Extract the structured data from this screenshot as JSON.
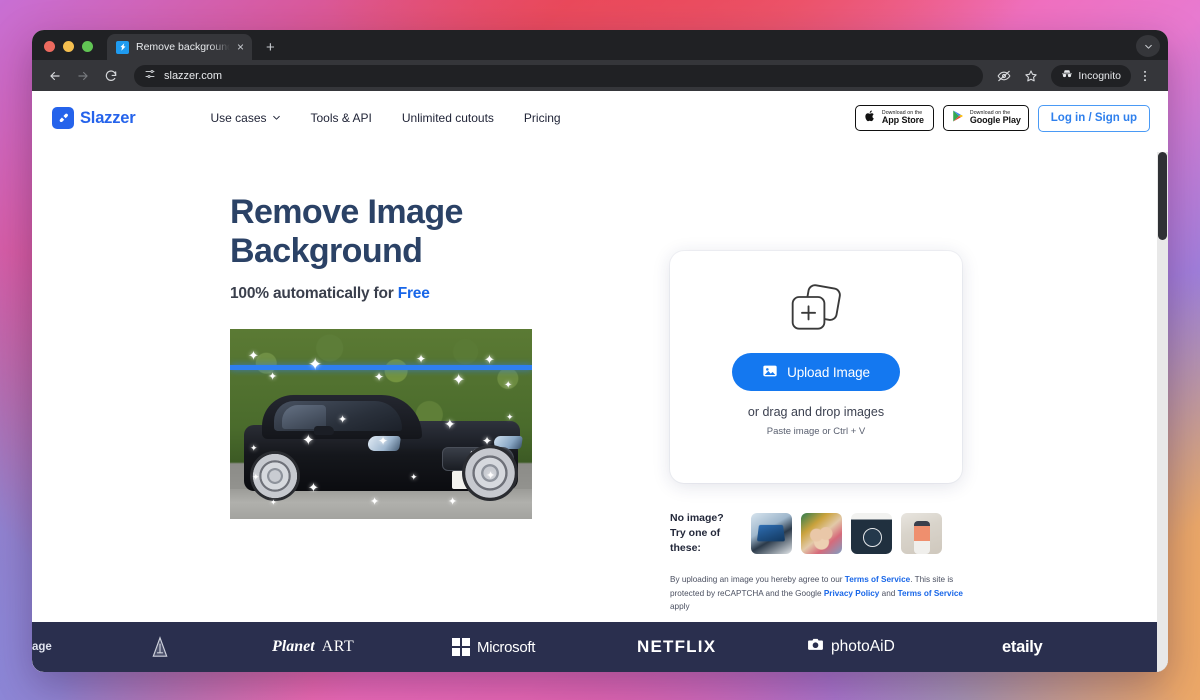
{
  "browser": {
    "tab": {
      "title": "Remove background from ima",
      "favicon": "slazzer-favicon",
      "close": "×"
    },
    "new_tab": "+",
    "tabstrip_menu": "chevron-down-icon",
    "toolbar": {
      "back": "back-arrow-icon",
      "forward": "forward-arrow-icon",
      "reload": "reload-icon",
      "site_info": "tune-icon",
      "url": "slazzer.com",
      "tracking_protection": "eye-slash-icon",
      "bookmark": "star-icon",
      "incognito_label": "Incognito",
      "menu": "three-dot-icon"
    }
  },
  "site": {
    "logo": {
      "text": "Slazzer",
      "mark": "slazzer-logo-icon"
    },
    "nav": [
      {
        "label": "Use cases",
        "has_caret": true
      },
      {
        "label": "Tools & API",
        "has_caret": false
      },
      {
        "label": "Unlimited cutouts",
        "has_caret": false
      },
      {
        "label": "Pricing",
        "has_caret": false
      }
    ],
    "app_store": {
      "small": "Download on the",
      "large": "App Store",
      "icon": "apple-icon"
    },
    "google_play": {
      "small": "Download on the",
      "large": "Google Play",
      "icon": "google-play-icon"
    },
    "login": "Log in / Sign up"
  },
  "hero": {
    "title_line1": "Remove Image",
    "title_line2": "Background",
    "subtitle_prefix": "100% automatically for ",
    "subtitle_highlight": "Free",
    "image_alt": "black-mercedes-coupe-with-sparkles"
  },
  "upload": {
    "stack_icon": "add-images-icon",
    "button_label": "Upload Image",
    "button_icon": "picture-icon",
    "drag_text": "or drag and drop images",
    "paste_text": "Paste image or Ctrl + V",
    "button_color": "#1478f0"
  },
  "samples": {
    "label_line1": "No image?",
    "label_line2": "Try one of these:",
    "thumbs": [
      {
        "name": "sample-laptop"
      },
      {
        "name": "sample-three-women"
      },
      {
        "name": "sample-product-can"
      },
      {
        "name": "sample-woman-in-hat"
      }
    ]
  },
  "legal": {
    "part1": "By uploading an image you hereby agree to our ",
    "link1": "Terms of Service",
    "part2": ". This site is protected by reCAPTCHA and the Google ",
    "link2": "Privacy Policy",
    "part3": " and ",
    "link3": "Terms of Service",
    "part4": " apply"
  },
  "brands": [
    {
      "name": "brand-partial",
      "label": "age"
    },
    {
      "name": "brand-a-logo",
      "label": ""
    },
    {
      "name": "brand-planetart",
      "label_script": "Planet",
      "label_serif": "ART"
    },
    {
      "name": "brand-microsoft",
      "label": "Microsoft"
    },
    {
      "name": "brand-netflix",
      "label": "NETFLIX"
    },
    {
      "name": "brand-photoaid",
      "label": "photoAiD"
    },
    {
      "name": "brand-etaily",
      "label": "etaily"
    }
  ],
  "theme": {
    "brand_blue": "#2563eb",
    "heading_navy": "#2b4266",
    "footer_navy": "#2a2f4e",
    "link_blue": "#1866e8"
  }
}
